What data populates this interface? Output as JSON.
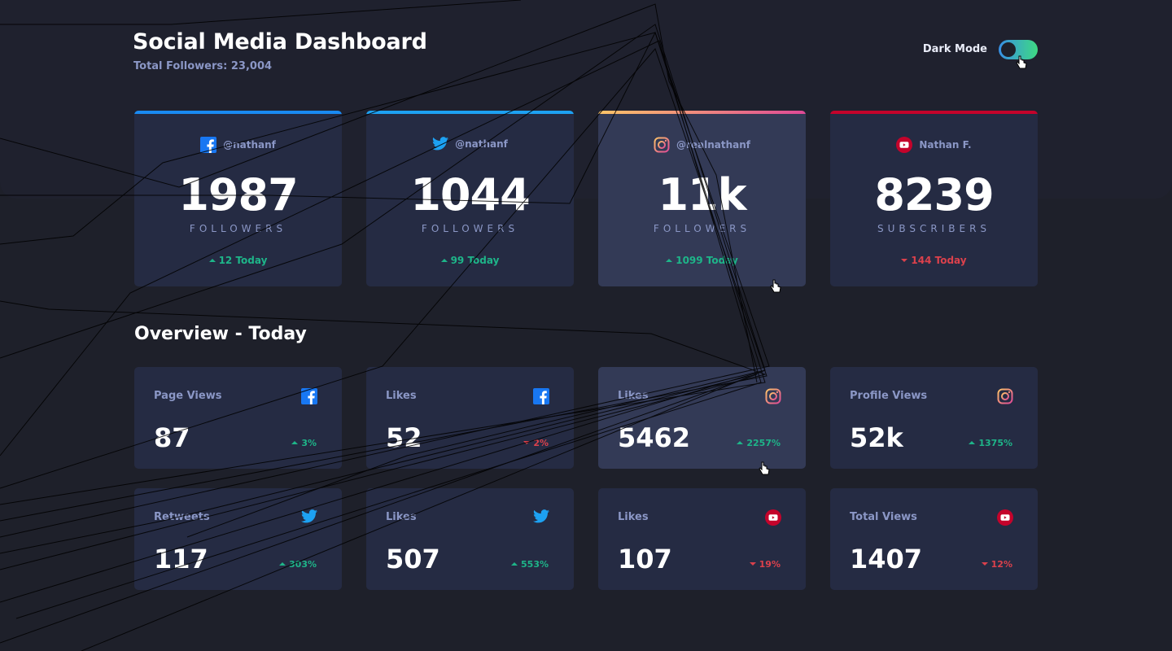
{
  "header": {
    "title": "Social Media Dashboard",
    "total_followers": "Total Followers: 23,004",
    "dark_mode_label": "Dark Mode",
    "dark_mode_on": true
  },
  "colors": {
    "facebook": "#1877f2",
    "twitter": "#1da1f2",
    "instagram_start": "#fdc468",
    "instagram_end": "#df4996",
    "youtube": "#c4032b",
    "up": "#1eb589",
    "down": "#dc414c"
  },
  "cards": [
    {
      "network": "facebook",
      "icon": "facebook-icon",
      "handle": "@nathanf",
      "count": "1987",
      "unit": "FOLLOWERS",
      "change": "12 Today",
      "trend": "up"
    },
    {
      "network": "twitter",
      "icon": "twitter-icon",
      "handle": "@nathanf",
      "count": "1044",
      "unit": "FOLLOWERS",
      "change": "99 Today",
      "trend": "up"
    },
    {
      "network": "instagram",
      "icon": "instagram-icon",
      "handle": "@realnathanf",
      "count": "11k",
      "unit": "FOLLOWERS",
      "change": "1099 Today",
      "trend": "up"
    },
    {
      "network": "youtube",
      "icon": "youtube-icon",
      "handle": "Nathan F.",
      "count": "8239",
      "unit": "SUBSCRIBERS",
      "change": "144 Today",
      "trend": "down"
    }
  ],
  "overview": {
    "title": "Overview - Today",
    "items": [
      {
        "label": "Page Views",
        "network": "facebook",
        "icon": "facebook-icon",
        "value": "87",
        "pct": "3%",
        "trend": "up"
      },
      {
        "label": "Likes",
        "network": "facebook",
        "icon": "facebook-icon",
        "value": "52",
        "pct": "2%",
        "trend": "down"
      },
      {
        "label": "Likes",
        "network": "instagram",
        "icon": "instagram-icon",
        "value": "5462",
        "pct": "2257%",
        "trend": "up"
      },
      {
        "label": "Profile Views",
        "network": "instagram",
        "icon": "instagram-icon",
        "value": "52k",
        "pct": "1375%",
        "trend": "up"
      },
      {
        "label": "Retweets",
        "network": "twitter",
        "icon": "twitter-icon",
        "value": "117",
        "pct": "303%",
        "trend": "up"
      },
      {
        "label": "Likes",
        "network": "twitter",
        "icon": "twitter-icon",
        "value": "507",
        "pct": "553%",
        "trend": "up"
      },
      {
        "label": "Likes",
        "network": "youtube",
        "icon": "youtube-icon",
        "value": "107",
        "pct": "19%",
        "trend": "down"
      },
      {
        "label": "Total Views",
        "network": "youtube",
        "icon": "youtube-icon",
        "value": "1407",
        "pct": "12%",
        "trend": "down"
      }
    ]
  }
}
